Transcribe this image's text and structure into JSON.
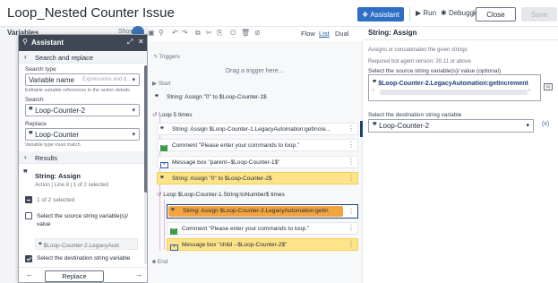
{
  "header": {
    "title": "Loop_Nested Counter Issue",
    "assistant_label": "Assistant",
    "run_label": "Run",
    "debugger_label": "Debugger",
    "more_label": "⋮",
    "close_label": "Close",
    "save_label": "Save"
  },
  "left": {
    "variables_label": "Variables",
    "show_label": "Show"
  },
  "assistant": {
    "title": "Assistant",
    "section_label": "Search and replace",
    "search_type_label": "Search type",
    "search_type_value": "Variable name",
    "search_type_placeholder": "Expressions and d...",
    "search_type_hint": "Editable variable references in the action details",
    "search_label": "Search",
    "search_value": "Loop-Counter-2",
    "replace_label": "Replace",
    "replace_value": "Loop-Counter",
    "replace_hint": "Variable type must match",
    "results_label": "Results",
    "result_title": "String: Assign",
    "result_sub": "Action | Line 8 | 1 of 2 selected",
    "selected_count": "1 of 2 selected",
    "opt1_label": "Select the source string variable(s)/ value",
    "opt1_value": "$Loop-Counter-2.LegacyAutc",
    "opt2_label": "Select the destination string variable",
    "replace_button": "Replace",
    "prev_label": "←",
    "next_label": "→"
  },
  "toolbar": {
    "views": [
      "Flow",
      "List",
      "Dual"
    ],
    "active_view": "List"
  },
  "flow": {
    "triggers_label": "Triggers",
    "drag_hint": "Drag a trigger here...",
    "start_label": "Start",
    "end_label": "End",
    "steps": [
      "String: Assign \"0\" to $Loop-Counter-1$",
      "Loop  5 times",
      "String: Assign $Loop-Counter-1.LegacyAutomation:getIncre...",
      "Comment \"Please enter your commands to loop.\"",
      "Message box \"parent--$Loop-Counter-1$\"",
      "String: Assign \"0\" to $Loop-Counter-2$",
      "Loop  $Loop-Counter-1.String:toNumber$ times",
      "String: Assign $Loop-Counter-2.LegacyAutomation:getIn",
      "Comment \"Please enter your commands to loop.\"",
      "Message box \"child --$Loop-Counter-2$\""
    ]
  },
  "right": {
    "title": "String: Assign",
    "desc": "Assigns or concatenates the given strings",
    "version": "Required bot agent version: 20.11 or above",
    "source_label": "Select the source string variable(s)/ value (optional)",
    "source_value": "$Loop-Counter-2.LegacyAutomation:getIncrement",
    "dest_label": "Select the destination string variable",
    "dest_value": "Loop-Counter-2"
  }
}
